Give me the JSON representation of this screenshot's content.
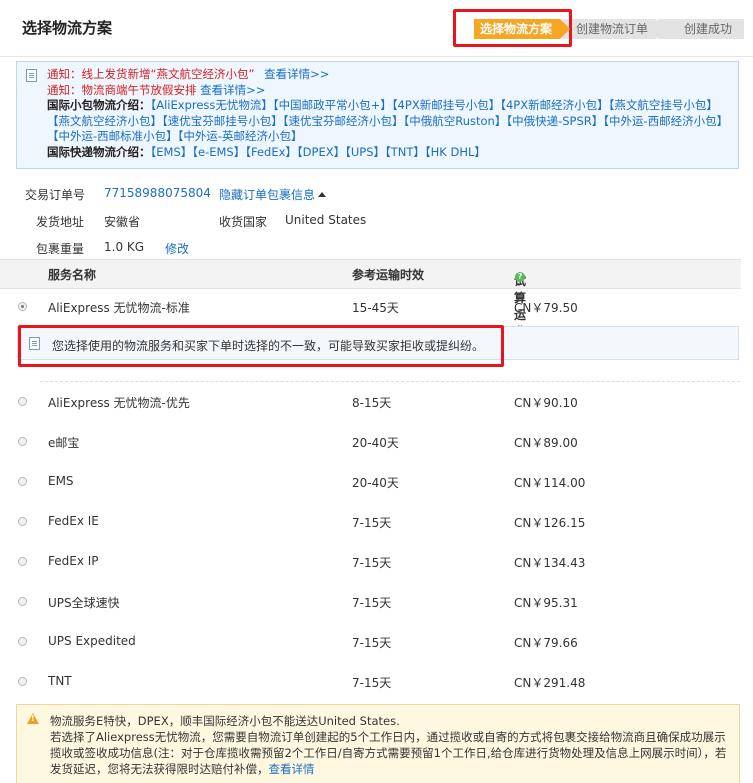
{
  "header": {
    "title": "选择物流方案",
    "steps": [
      "选择物流方案",
      "创建物流订单",
      "创建成功"
    ]
  },
  "notice": {
    "line1": "通知：线上发货新增“燕文航空经济小包”",
    "line1_link": "查看详情>>",
    "line2": "通知：物流商端午节放假安排",
    "line2_link": "查看详情>>",
    "intl_small_label": "国际小包物流介绍：",
    "intl_small_links": [
      "【AliExpress无忧物流】",
      "【中国邮政平常小包+】",
      "【4PX新邮挂号小包】",
      "【4PX新邮经济小包】",
      "【燕文航空挂号小包】",
      "【燕文航空经济小包】",
      "【速优宝芬邮挂号小包】",
      "【速优宝芬邮经济小包】",
      "【中俄航空Ruston】",
      "【中俄快递-SPSR】",
      "【中外运-西邮经济小包】",
      "【中外运-西邮标准小包】",
      "【中外运-英邮经济小包】"
    ],
    "express_label": "国际快递物流介绍：",
    "express_links": [
      "【EMS】",
      "【e-EMS】",
      "【FedEx】",
      "【DPEX】",
      "【UPS】",
      "【TNT】",
      "【HK DHL】"
    ]
  },
  "order": {
    "order_no_label": "交易订单号",
    "order_no": "77158988075804",
    "hide_link": "隐藏订单包裹信息",
    "ship_from_label": "发货地址",
    "ship_from": "安徽省",
    "dest_label": "收货国家",
    "dest": "United States",
    "weight_label": "包裹重量",
    "weight": "1.0 KG",
    "edit_link": "修改"
  },
  "table": {
    "headers": [
      "服务名称",
      "参考运输时效",
      "试算运费"
    ],
    "first_row": {
      "name": "AliExpress 无忧物流-标准",
      "time": "15-45天",
      "price": "CN￥79.50"
    },
    "warning": "您选择使用的物流服务和买家下单时选择的不一致，可能导致买家拒收或提纠纷。",
    "rows": [
      {
        "name": "AliExpress 无忧物流-优先",
        "time": "8-15天",
        "price": "CN￥90.10"
      },
      {
        "name": "e邮宝",
        "time": "20-40天",
        "price": "CN￥89.00"
      },
      {
        "name": "EMS",
        "time": "20-40天",
        "price": "CN￥114.00"
      },
      {
        "name": "FedEx IE",
        "time": "7-15天",
        "price": "CN￥126.15"
      },
      {
        "name": "FedEx IP",
        "time": "7-15天",
        "price": "CN￥134.43"
      },
      {
        "name": "UPS全球速快",
        "time": "7-15天",
        "price": "CN￥95.31"
      },
      {
        "name": "UPS Expedited",
        "time": "7-15天",
        "price": "CN￥79.66"
      },
      {
        "name": "TNT",
        "time": "7-15天",
        "price": "CN￥291.48"
      }
    ]
  },
  "bottom_note": {
    "line1": "物流服务E特快，DPEX，顺丰国际经济小包不能送达United States.",
    "line2": "若选择了Aliexpress无忧物流，您需要自物流订单创建起的5个工作日内，通过揽收或自寄的方式将包裹交接给物流商且确保成功展示揽收或签收成功信息(注：对于仓库揽收需预留2个工作日/自寄方式需要预留1个工作日,给仓库进行货物处理及信息上网展示时间），若发货延迟，您将无法获得限时达赔付补偿，",
    "link": "查看详情"
  },
  "colors": {
    "accent": "#f5a623",
    "highlight": "#e8161c",
    "link": "#1a6ec4",
    "notice_red": "#d9201c"
  },
  "icons": [
    "document-icon",
    "caret-up-icon",
    "question-icon",
    "radio-icon",
    "warning-icon"
  ]
}
